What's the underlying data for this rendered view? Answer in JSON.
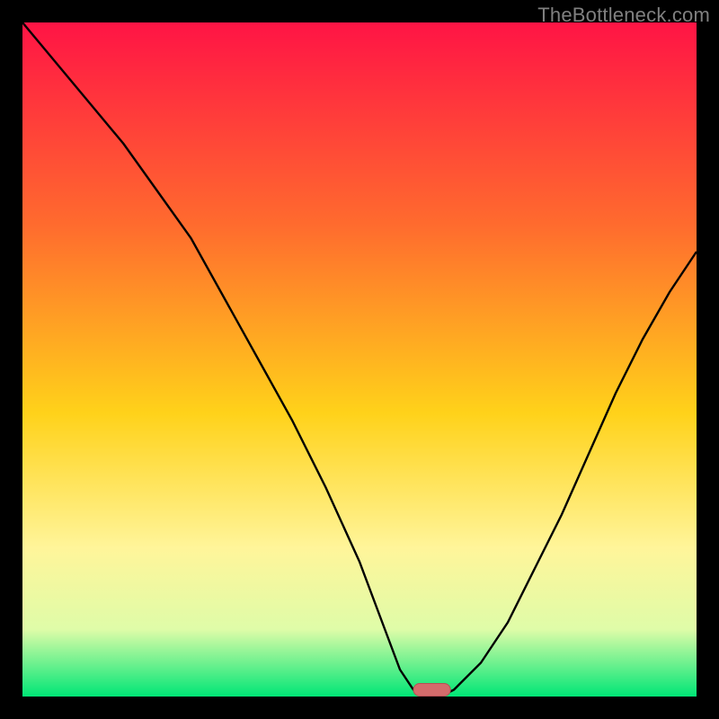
{
  "watermark": "TheBottleneck.com",
  "colors": {
    "frame": "#000000",
    "gradient_top": "#ff1445",
    "gradient_mid_upper": "#ff6b2e",
    "gradient_mid": "#ffd21a",
    "gradient_mid_lower": "#fff59a",
    "gradient_low": "#dffca8",
    "gradient_bottom": "#00e676",
    "curve": "#000000",
    "marker_fill": "#d36b6b",
    "marker_stroke": "#b74f54"
  },
  "chart_data": {
    "type": "line",
    "title": "",
    "xlabel": "",
    "ylabel": "",
    "xlim": [
      0,
      100
    ],
    "ylim": [
      0,
      100
    ],
    "series": [
      {
        "name": "bottleneck-curve",
        "x": [
          0,
          5,
          10,
          15,
          20,
          25,
          30,
          35,
          40,
          45,
          50,
          53,
          56,
          58,
          60,
          62,
          64,
          68,
          72,
          76,
          80,
          84,
          88,
          92,
          96,
          100
        ],
        "y": [
          100,
          94,
          88,
          82,
          75,
          68,
          59,
          50,
          41,
          31,
          20,
          12,
          4,
          1,
          0,
          0,
          1,
          5,
          11,
          19,
          27,
          36,
          45,
          53,
          60,
          66
        ]
      }
    ],
    "marker": {
      "x_start": 58,
      "x_end": 63.5,
      "y": 1.0
    },
    "gradient_stops": [
      {
        "pct": 0,
        "key": "gradient_top"
      },
      {
        "pct": 30,
        "key": "gradient_mid_upper"
      },
      {
        "pct": 58,
        "key": "gradient_mid"
      },
      {
        "pct": 78,
        "key": "gradient_mid_lower"
      },
      {
        "pct": 90,
        "key": "gradient_low"
      },
      {
        "pct": 100,
        "key": "gradient_bottom"
      }
    ]
  }
}
